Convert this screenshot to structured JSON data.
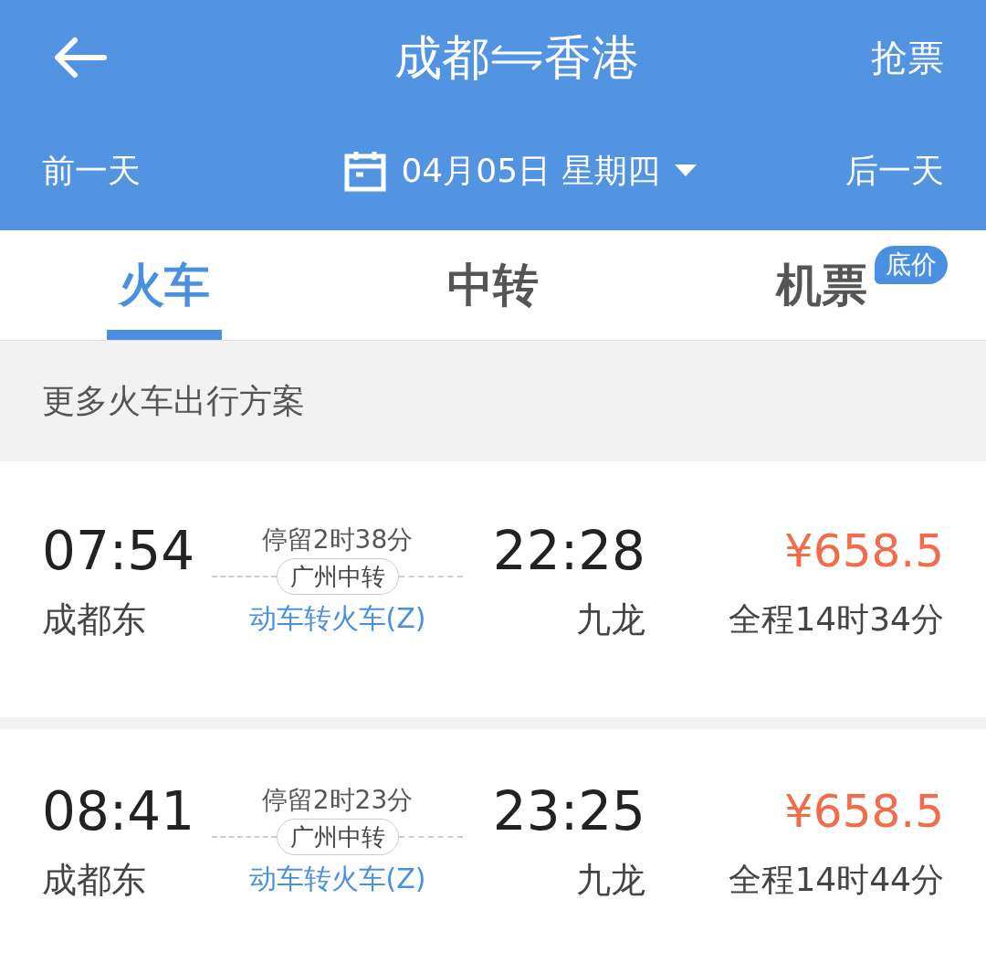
{
  "header": {
    "from": "成都",
    "to": "香港",
    "action": "抢票"
  },
  "date_bar": {
    "prev": "前一天",
    "date": "04月05日 星期四",
    "next": "后一天"
  },
  "tabs": [
    {
      "label": "火车",
      "selected": true
    },
    {
      "label": "中转",
      "selected": false
    },
    {
      "label": "机票",
      "selected": false,
      "badge": "底价"
    }
  ],
  "section_title": "更多火车出行方案",
  "trips": [
    {
      "depart_time": "07:54",
      "depart_station": "成都东",
      "stopover": "停留2时38分",
      "transfer": "广州中转",
      "train_type": "动车转火车(Z)",
      "arrive_time": "22:28",
      "arrive_station": "九龙",
      "price": "¥658.5",
      "duration": "全程14时34分"
    },
    {
      "depart_time": "08:41",
      "depart_station": "成都东",
      "stopover": "停留2时23分",
      "transfer": "广州中转",
      "train_type": "动车转火车(Z)",
      "arrive_time": "23:25",
      "arrive_station": "九龙",
      "price": "¥658.5",
      "duration": "全程14时44分"
    }
  ]
}
